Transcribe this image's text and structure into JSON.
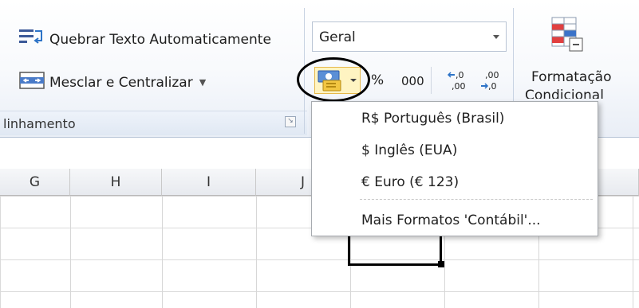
{
  "ribbon": {
    "wrap_text_label": "Quebrar Texto Automaticamente",
    "merge_center_label": "Mesclar e Centralizar",
    "alignment_group_label": "linhamento",
    "number_format_value": "Geral",
    "percent_label": "%",
    "thousands_label": "000",
    "cond_format_line1": "Formatação",
    "cond_format_line2": "Condicional"
  },
  "columns": [
    "G",
    "H",
    "I",
    "J"
  ],
  "accounting_menu": {
    "items": [
      "R$ Português (Brasil)",
      "$ Inglês (EUA)",
      "€ Euro (€ 123)"
    ],
    "more_label": "Mais Formatos 'Contábil'..."
  }
}
